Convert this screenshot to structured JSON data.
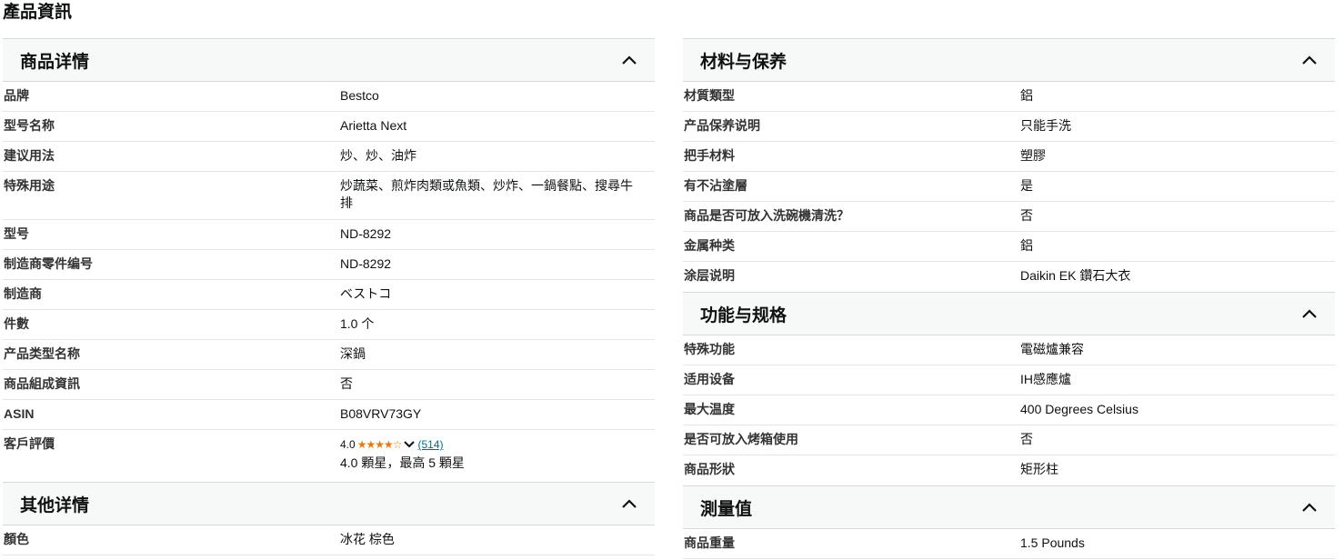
{
  "page_title": "產品資訊",
  "left": {
    "product_details": {
      "title": "商品详情",
      "rows": [
        {
          "label": "品牌",
          "value": "Bestco"
        },
        {
          "label": "型号名称",
          "value": "Arietta Next"
        },
        {
          "label": "建议用法",
          "value": "炒、炒、油炸"
        },
        {
          "label": "特殊用途",
          "value": "炒蔬菜、煎炸肉類或魚類、炒炸、一鍋餐點、搜尋牛排"
        },
        {
          "label": "型号",
          "value": "ND-8292"
        },
        {
          "label": "制造商零件编号",
          "value": "ND-8292"
        },
        {
          "label": "制造商",
          "value": "ベストコ"
        },
        {
          "label": "件數",
          "value": "1.0 个"
        },
        {
          "label": "产品类型名称",
          "value": "深鍋"
        },
        {
          "label": "商品組成資訊",
          "value": "否"
        },
        {
          "label": "ASIN",
          "value": "B08VRV73GY"
        }
      ],
      "review": {
        "label": "客戶評價",
        "score": "4.0",
        "stars": "★★★★☆",
        "rating": 4.0,
        "count": "(514)",
        "summary": "4.0 顆星，最高 5 顆星"
      }
    },
    "other_details": {
      "title": "其他详情",
      "rows": [
        {
          "label": "顏色",
          "value": "冰花 棕色"
        }
      ]
    }
  },
  "right": {
    "materials": {
      "title": "材料与保养",
      "rows": [
        {
          "label": "材質類型",
          "value": "鋁"
        },
        {
          "label": "产品保养说明",
          "value": "只能手洗"
        },
        {
          "label": "把手材料",
          "value": "塑膠"
        },
        {
          "label": "有不沾塗層",
          "value": "是"
        },
        {
          "label": "商品是否可放入洗碗機清洗？",
          "value": "否"
        },
        {
          "label": "金属种类",
          "value": "鋁"
        },
        {
          "label": "涂层说明",
          "value": "Daikin EK 鑽石大衣"
        }
      ]
    },
    "features": {
      "title": "功能与规格",
      "rows": [
        {
          "label": "特殊功能",
          "value": "電磁爐兼容"
        },
        {
          "label": "适用设备",
          "value": "IH感應爐"
        },
        {
          "label": "最大温度",
          "value": "400 Degrees Celsius"
        },
        {
          "label": "是否可放入烤箱使用",
          "value": "否"
        },
        {
          "label": "商品形狀",
          "value": "矩形柱"
        }
      ]
    },
    "measurements": {
      "title": "測量值",
      "rows": [
        {
          "label": "商品重量",
          "value": "1.5 Pounds"
        }
      ]
    }
  },
  "icons": {
    "collapse": "chevron-up-icon",
    "expand_rating": "chevron-down-icon"
  }
}
